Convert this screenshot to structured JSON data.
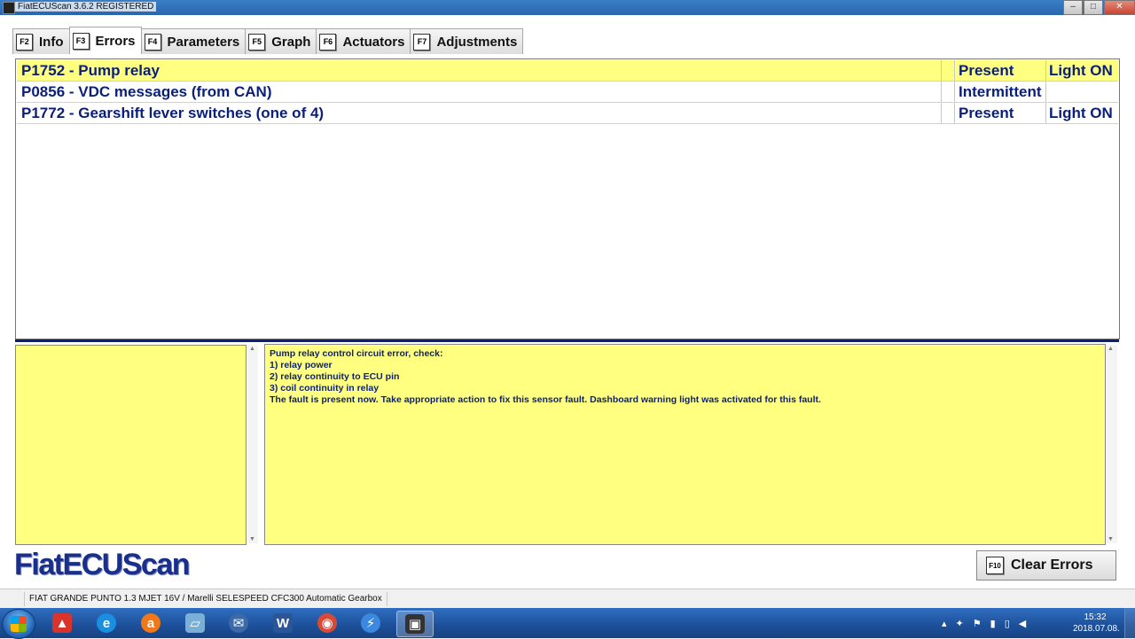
{
  "window": {
    "title": "FiatECUScan 3.6.2 REGISTERED",
    "minimize_glyph": "–",
    "maximize_glyph": "□",
    "close_glyph": "✕"
  },
  "tabs": [
    {
      "key": "F2",
      "label": "Info"
    },
    {
      "key": "F3",
      "label": "Errors",
      "active": true
    },
    {
      "key": "F4",
      "label": "Parameters"
    },
    {
      "key": "F5",
      "label": "Graph"
    },
    {
      "key": "F6",
      "label": "Actuators"
    },
    {
      "key": "F7",
      "label": "Adjustments"
    }
  ],
  "errors": [
    {
      "description": "P1752 - Pump relay",
      "status": "Present",
      "light": "Light ON",
      "selected": true
    },
    {
      "description": "P0856 - VDC messages (from CAN)",
      "status": "Intermittent",
      "light": ""
    },
    {
      "description": "P1772 - Gearshift lever switches (one of 4)",
      "status": "Present",
      "light": "Light ON"
    }
  ],
  "details": {
    "lines": [
      "Pump relay control circuit error, check:",
      "1) relay power",
      "2) relay continuity to ECU pin",
      "3) coil continuity in relay",
      "The fault is present now. Take appropriate action to fix this sensor fault. Dashboard warning light was activated for this fault."
    ]
  },
  "logo": "FiatECUScan",
  "clear_button": {
    "key": "F10",
    "label": "Clear Errors"
  },
  "status_bar": {
    "vehicle": "FIAT GRANDE PUNTO 1.3 MJET 16V / Marelli SELESPEED CFC300 Automatic Gearbox"
  },
  "taskbar": {
    "apps": [
      {
        "name": "app-icon-red",
        "glyph": "▲",
        "color": "#d8342c"
      },
      {
        "name": "internet-explorer-icon",
        "glyph": "e",
        "color": "#1a8fe0"
      },
      {
        "name": "avast-icon",
        "glyph": "a",
        "color": "#f07818"
      },
      {
        "name": "files-icon",
        "glyph": "▱",
        "color": "#7ab0d8"
      },
      {
        "name": "thunderbird-icon",
        "glyph": "✉",
        "color": "#3c6aa8"
      },
      {
        "name": "word-icon",
        "glyph": "W",
        "color": "#2a5699"
      },
      {
        "name": "chrome-icon",
        "glyph": "◉",
        "color": "#d84a38"
      },
      {
        "name": "lightning-icon",
        "glyph": "⚡",
        "color": "#3b88e0"
      },
      {
        "name": "fiatecuscan-icon",
        "glyph": "▣",
        "color": "#333333",
        "active": true
      }
    ],
    "tray_icons": [
      {
        "name": "tray-expand-icon",
        "glyph": "▴"
      },
      {
        "name": "tray-app-icon",
        "glyph": "✦"
      },
      {
        "name": "tray-flag-icon",
        "glyph": "⚑"
      },
      {
        "name": "tray-network-icon",
        "glyph": "▮"
      },
      {
        "name": "tray-battery-icon",
        "glyph": "▯"
      },
      {
        "name": "tray-volume-icon",
        "glyph": "◀"
      }
    ],
    "time": "15:32",
    "date": "2018.07.08."
  }
}
